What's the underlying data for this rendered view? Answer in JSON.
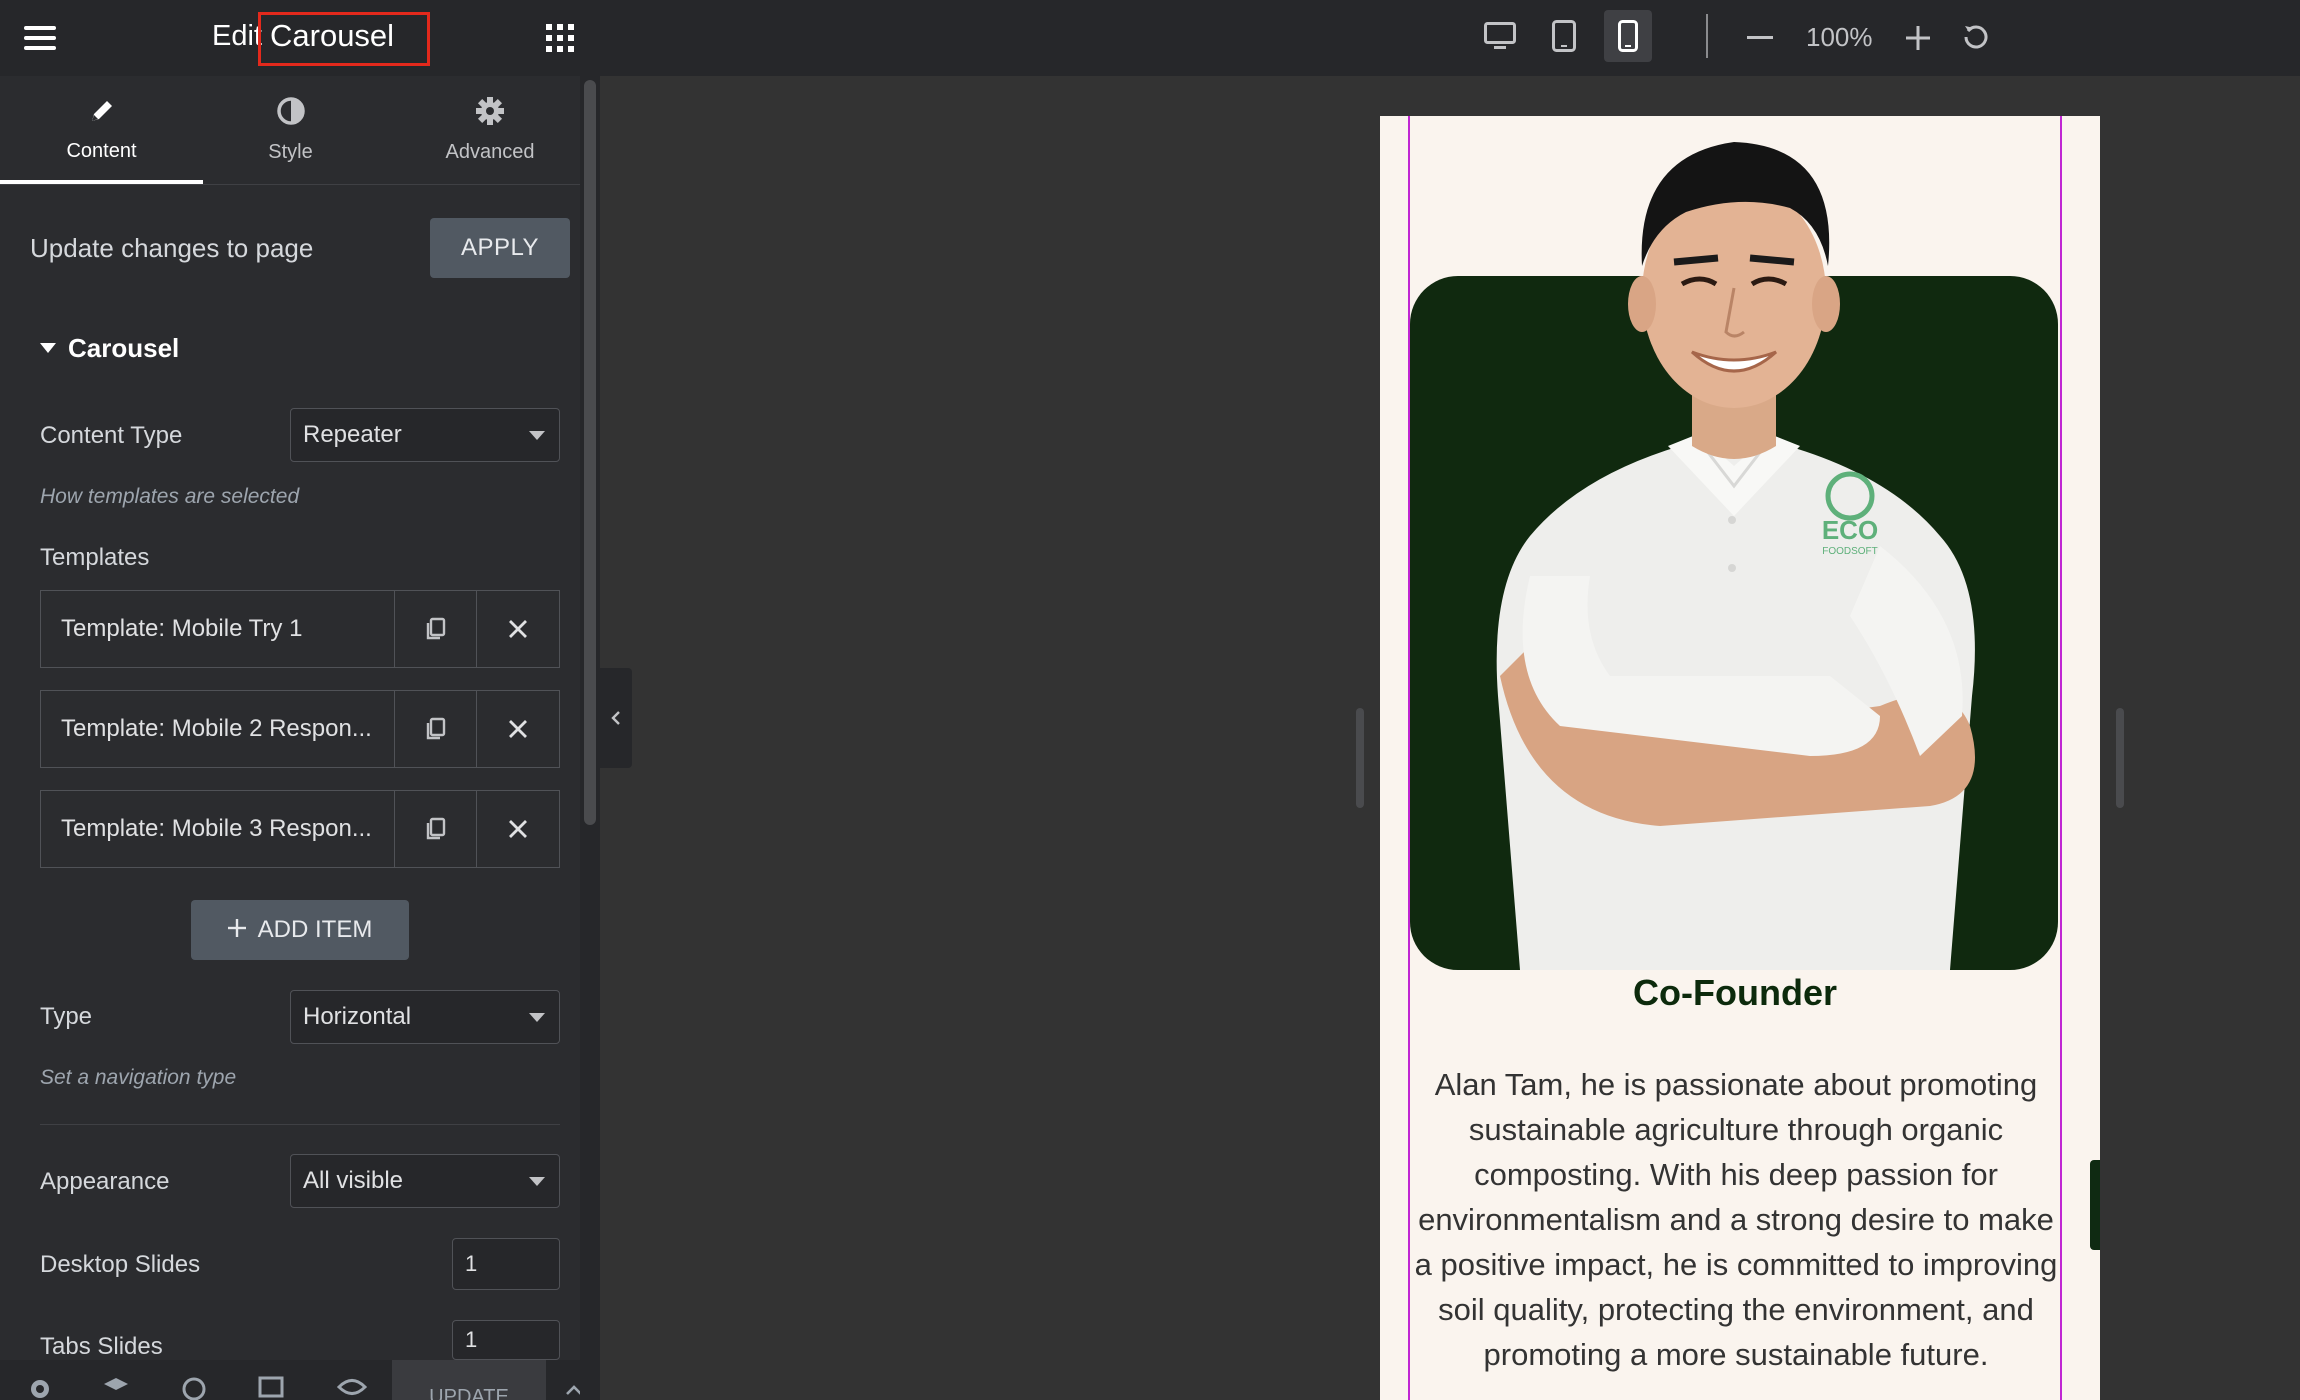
{
  "header": {
    "title_prefix": "Edit",
    "title": "Carousel",
    "zoom": "100%",
    "icons": {
      "menu": "hamburger-menu-icon",
      "apps": "grid-apps-icon",
      "desktop": "desktop-icon",
      "tablet": "tablet-icon",
      "mobile": "mobile-icon",
      "zoom_out": "minus-icon",
      "zoom_in": "plus-icon",
      "reset": "reset-icon"
    }
  },
  "tabs": [
    {
      "label": "Content",
      "icon": "pencil-icon",
      "active": true
    },
    {
      "label": "Style",
      "icon": "contrast-icon",
      "active": false
    },
    {
      "label": "Advanced",
      "icon": "gear-icon",
      "active": false
    }
  ],
  "apply": {
    "text": "Update changes to page",
    "button": "APPLY"
  },
  "section": {
    "title": "Carousel"
  },
  "content_type": {
    "label": "Content Type",
    "value": "Repeater",
    "hint": "How templates are selected"
  },
  "templates": {
    "label": "Templates",
    "items": [
      {
        "title": "Template: Mobile Try 1"
      },
      {
        "title": "Template: Mobile 2 Respon..."
      },
      {
        "title": "Template: Mobile 3 Respon..."
      }
    ],
    "add_button": "ADD ITEM"
  },
  "nav_type": {
    "label": "Type",
    "value": "Horizontal",
    "hint": "Set a navigation type"
  },
  "appearance": {
    "label": "Appearance",
    "value": "All visible"
  },
  "desktop_slides": {
    "label": "Desktop Slides",
    "value": "1"
  },
  "tabs_slides": {
    "label": "Tabs Slides",
    "value": "1"
  },
  "footer": {
    "update": "UPDATE"
  },
  "preview": {
    "logo_text": "ECO",
    "logo_sub": "FOODSOFT",
    "role": "Co-Founder",
    "bio": "Alan Tam, he is passionate about promoting sustainable agriculture through organic composting. With his deep passion for environmentalism and a strong desire to make a positive impact, he is committed to improving soil quality, protecting the environment, and promoting a more sustainable future."
  },
  "colors": {
    "panel_bg": "#2b2c2f",
    "topbar_bg": "#26272a",
    "canvas_bg": "#333333",
    "button_bg": "#515962",
    "preview_bg": "#faf4ee",
    "card_green": "#10290f",
    "highlight": "#e3291c",
    "selection": "#c026d3"
  }
}
